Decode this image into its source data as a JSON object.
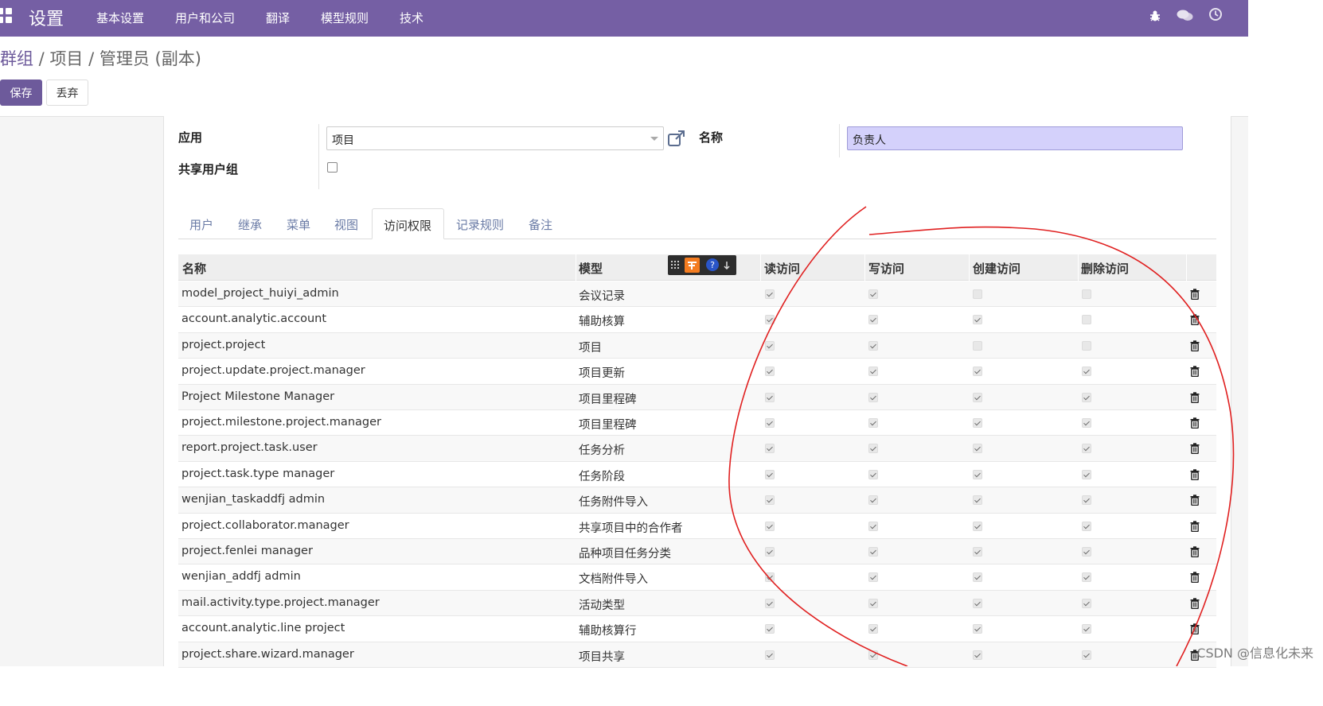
{
  "topbar": {
    "app_title": "设置",
    "menu": [
      "基本设置",
      "用户和公司",
      "翻译",
      "模型规则",
      "技术"
    ],
    "accent_color": "#755fa4"
  },
  "breadcrumb": {
    "parent": "群组",
    "sep": " / ",
    "current": "项目 / 管理员 (副本)"
  },
  "actions": {
    "save": "保存",
    "discard": "丢弃"
  },
  "form": {
    "application_label": "应用",
    "application_value": "项目",
    "name_label": "名称",
    "name_value": "负责人",
    "shared_label": "共享用户组",
    "shared_checked": false
  },
  "tabs": [
    "用户",
    "继承",
    "菜单",
    "视图",
    "访问权限",
    "记录规则",
    "备注"
  ],
  "active_tab": "访问权限",
  "table": {
    "headers": [
      "名称",
      "模型",
      "读访问",
      "写访问",
      "创建访问",
      "删除访问"
    ],
    "rows": [
      {
        "name": "model_project_huiyi_admin",
        "model": "会议记录",
        "read": true,
        "write": true,
        "create": false,
        "delete": false
      },
      {
        "name": "account.analytic.account",
        "model": "辅助核算",
        "read": true,
        "write": true,
        "create": true,
        "delete": false
      },
      {
        "name": "project.project",
        "model": "项目",
        "read": true,
        "write": true,
        "create": false,
        "delete": false
      },
      {
        "name": "project.update.project.manager",
        "model": "项目更新",
        "read": true,
        "write": true,
        "create": true,
        "delete": true
      },
      {
        "name": "Project Milestone Manager",
        "model": "项目里程碑",
        "read": true,
        "write": true,
        "create": true,
        "delete": true
      },
      {
        "name": "project.milestone.project.manager",
        "model": "项目里程碑",
        "read": true,
        "write": true,
        "create": true,
        "delete": true
      },
      {
        "name": "report.project.task.user",
        "model": "任务分析",
        "read": true,
        "write": true,
        "create": true,
        "delete": true
      },
      {
        "name": "project.task.type manager",
        "model": "任务阶段",
        "read": true,
        "write": true,
        "create": true,
        "delete": true
      },
      {
        "name": "wenjian_taskaddfj admin",
        "model": "任务附件导入",
        "read": true,
        "write": true,
        "create": true,
        "delete": true
      },
      {
        "name": "project.collaborator.manager",
        "model": "共享项目中的合作者",
        "read": true,
        "write": true,
        "create": true,
        "delete": true
      },
      {
        "name": "project.fenlei manager",
        "model": "品种项目任务分类",
        "read": true,
        "write": true,
        "create": true,
        "delete": true
      },
      {
        "name": "wenjian_addfj admin",
        "model": "文档附件导入",
        "read": true,
        "write": true,
        "create": true,
        "delete": true
      },
      {
        "name": "mail.activity.type.project.manager",
        "model": "活动类型",
        "read": true,
        "write": true,
        "create": true,
        "delete": true
      },
      {
        "name": "account.analytic.line project",
        "model": "辅助核算行",
        "read": true,
        "write": true,
        "create": true,
        "delete": true
      },
      {
        "name": "project.share.wizard.manager",
        "model": "项目共享",
        "read": true,
        "write": true,
        "create": true,
        "delete": true
      }
    ]
  },
  "watermark": "CSDN @信息化未来"
}
